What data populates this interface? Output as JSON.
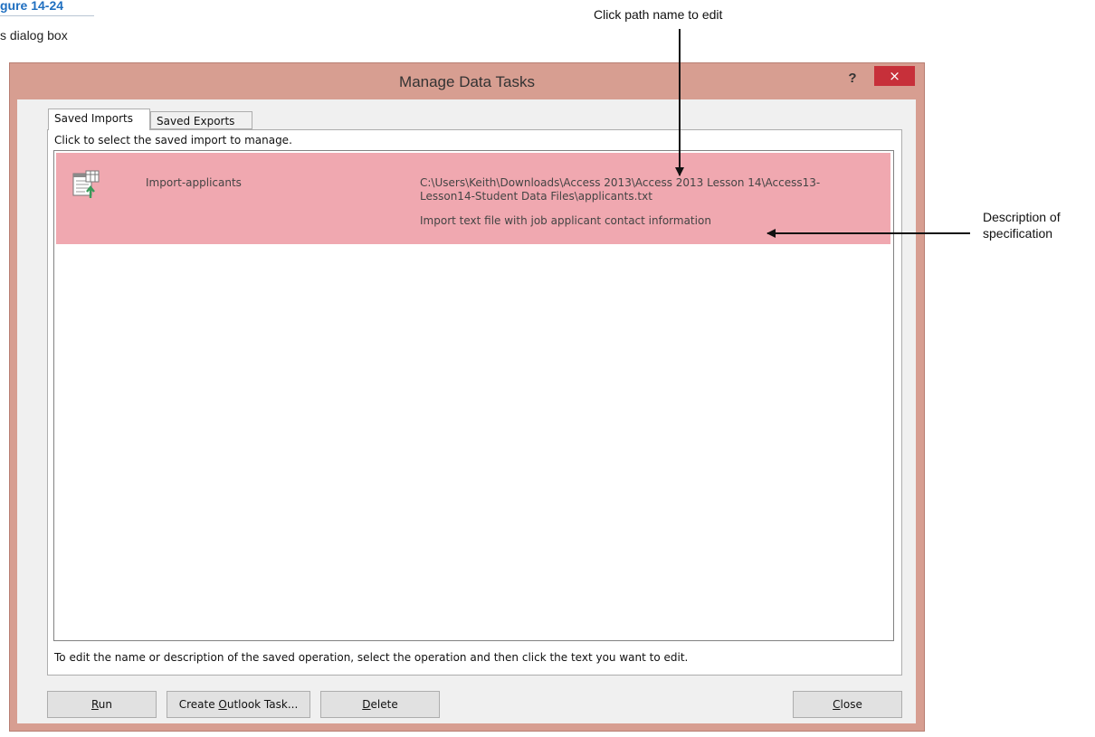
{
  "figure": {
    "label": "gure 14-24",
    "caption": "s dialog box",
    "callout_path": "Click path name to edit",
    "callout_desc": "Description of specification"
  },
  "dialog": {
    "title": "Manage Data Tasks",
    "help_label": "?",
    "close_glyph": "×",
    "tabs": [
      {
        "label": "Saved Imports",
        "selected": true
      },
      {
        "label": "Saved Exports",
        "selected": false
      }
    ],
    "instruction": "Click to select the saved import to manage.",
    "items": [
      {
        "name": "Import-applicants",
        "path": "C:\\Users\\Keith\\Downloads\\Access 2013\\Access 2013 Lesson 14\\Access13-Lesson14-Student Data Files\\applicants.txt",
        "description": "Import text file with job applicant contact information",
        "icon": "import-spec-icon"
      }
    ],
    "hint": "To edit the name or description of the saved operation, select the operation and then click the text you want to edit.",
    "buttons": {
      "run": {
        "label": "Run",
        "accesskey": "R"
      },
      "outlook": {
        "label": "Create Outlook Task...",
        "accesskey": "O"
      },
      "delete": {
        "label": "Delete",
        "accesskey": "D"
      },
      "close": {
        "label": "Close",
        "accesskey": "C"
      }
    }
  },
  "colors": {
    "title_bar": "#d79e91",
    "selected_row": "#f0a8b0",
    "close_button": "#c7303a",
    "figure_label": "#1f6fc0"
  }
}
